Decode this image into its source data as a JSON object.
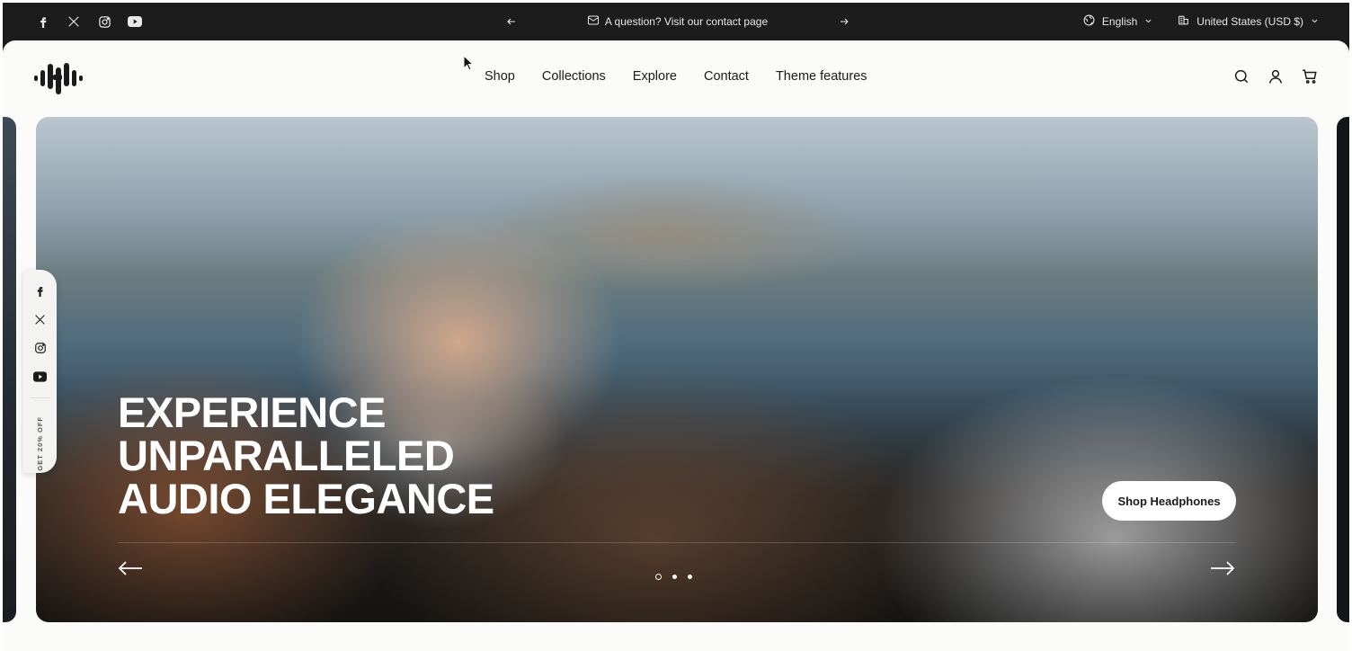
{
  "announcement_bar": {
    "social": [
      {
        "name": "facebook-icon"
      },
      {
        "name": "x-icon"
      },
      {
        "name": "instagram-icon"
      },
      {
        "name": "youtube-icon"
      }
    ],
    "message": "A question? Visit our contact page",
    "language": "English",
    "currency": "United States (USD $)"
  },
  "header": {
    "nav": [
      "Shop",
      "Collections",
      "Explore",
      "Contact",
      "Theme features"
    ],
    "icons": [
      "search-icon",
      "account-icon",
      "cart-icon"
    ]
  },
  "hero": {
    "headline": [
      "EXPERIENCE",
      "UNPARALLELED",
      "AUDIO ELEGANCE"
    ],
    "cta_label": "Shop Headphones",
    "slide_count": 3,
    "active_slide": 1
  },
  "side_bar": {
    "promo": "GET 20% OFF"
  },
  "colors": {
    "topbar_bg": "#1c1c1c",
    "panel_bg": "#fbfbfa",
    "cta_bg": "#ffffff"
  }
}
